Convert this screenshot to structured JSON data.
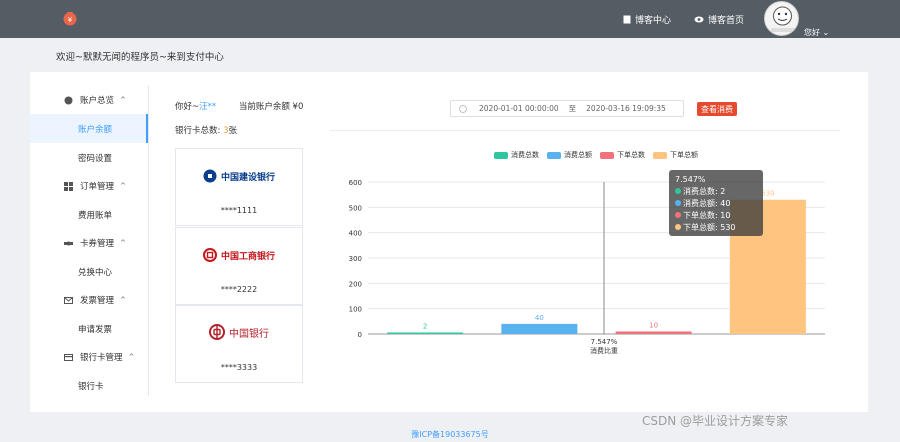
{
  "header": {
    "blog_center": "博客中心",
    "blog_home": "博客首页",
    "user_greeting": "您好",
    "colors": {
      "bar": "#545c64",
      "logo": "#e8664a"
    }
  },
  "welcome_text": "欢迎~默默无闻的程序员~来到支付中心",
  "sidebar": {
    "groups": [
      {
        "label": "账户总览",
        "icon": "user-icon",
        "items": [
          "账户余额",
          "密码设置"
        ]
      },
      {
        "label": "订单管理",
        "icon": "grid-icon",
        "items": [
          "费用账单"
        ]
      },
      {
        "label": "卡券管理",
        "icon": "ticket-icon",
        "items": [
          "兑换中心"
        ]
      },
      {
        "label": "发票管理",
        "icon": "mail-icon",
        "items": [
          "申请发票"
        ]
      },
      {
        "label": "银行卡管理",
        "icon": "card-icon",
        "items": [
          "银行卡"
        ]
      }
    ],
    "active_item": "账户余额"
  },
  "account": {
    "greet_prefix": "你好~",
    "name": "汪**",
    "balance_label": "当前账户余额 ¥",
    "balance": "0",
    "card_count_label": "银行卡总数: ",
    "card_count": "3",
    "card_count_unit": "张"
  },
  "cards": [
    {
      "bank": "中国建设银行",
      "number": "****1111",
      "color": "#0b3f8c"
    },
    {
      "bank": "中国工商银行",
      "number": "****2222",
      "color": "#c4161c"
    },
    {
      "bank": "中国银行",
      "number": "****3333",
      "color": "#b3202a"
    }
  ],
  "filter": {
    "start": "2020-01-01 00:00:00",
    "separator": "至",
    "end": "2020-03-16 19:09:35",
    "query_button": "查看消费"
  },
  "chart_data": {
    "type": "bar",
    "series_names": [
      "消费总数",
      "消费总额",
      "下单总数",
      "下单总额"
    ],
    "values": [
      2,
      40,
      10,
      530
    ],
    "colors": [
      "#2ec7a0",
      "#5ab1ef",
      "#f0727c",
      "#ffc480"
    ],
    "ylim": [
      0,
      600
    ],
    "yticks": [
      0,
      100,
      200,
      300,
      400,
      500,
      600
    ],
    "x_label_value": "7.547%",
    "x_label": "消费比重"
  },
  "tooltip": {
    "title": "7.547%",
    "rows": [
      {
        "label": "消费总数: ",
        "value": "2"
      },
      {
        "label": "消费总额: ",
        "value": "40"
      },
      {
        "label": "下单总数: ",
        "value": "10"
      },
      {
        "label": "下单总额: ",
        "value": "530"
      }
    ]
  },
  "footer": "豫ICP备19033675号",
  "watermark": "CSDN @毕业设计方案专家"
}
